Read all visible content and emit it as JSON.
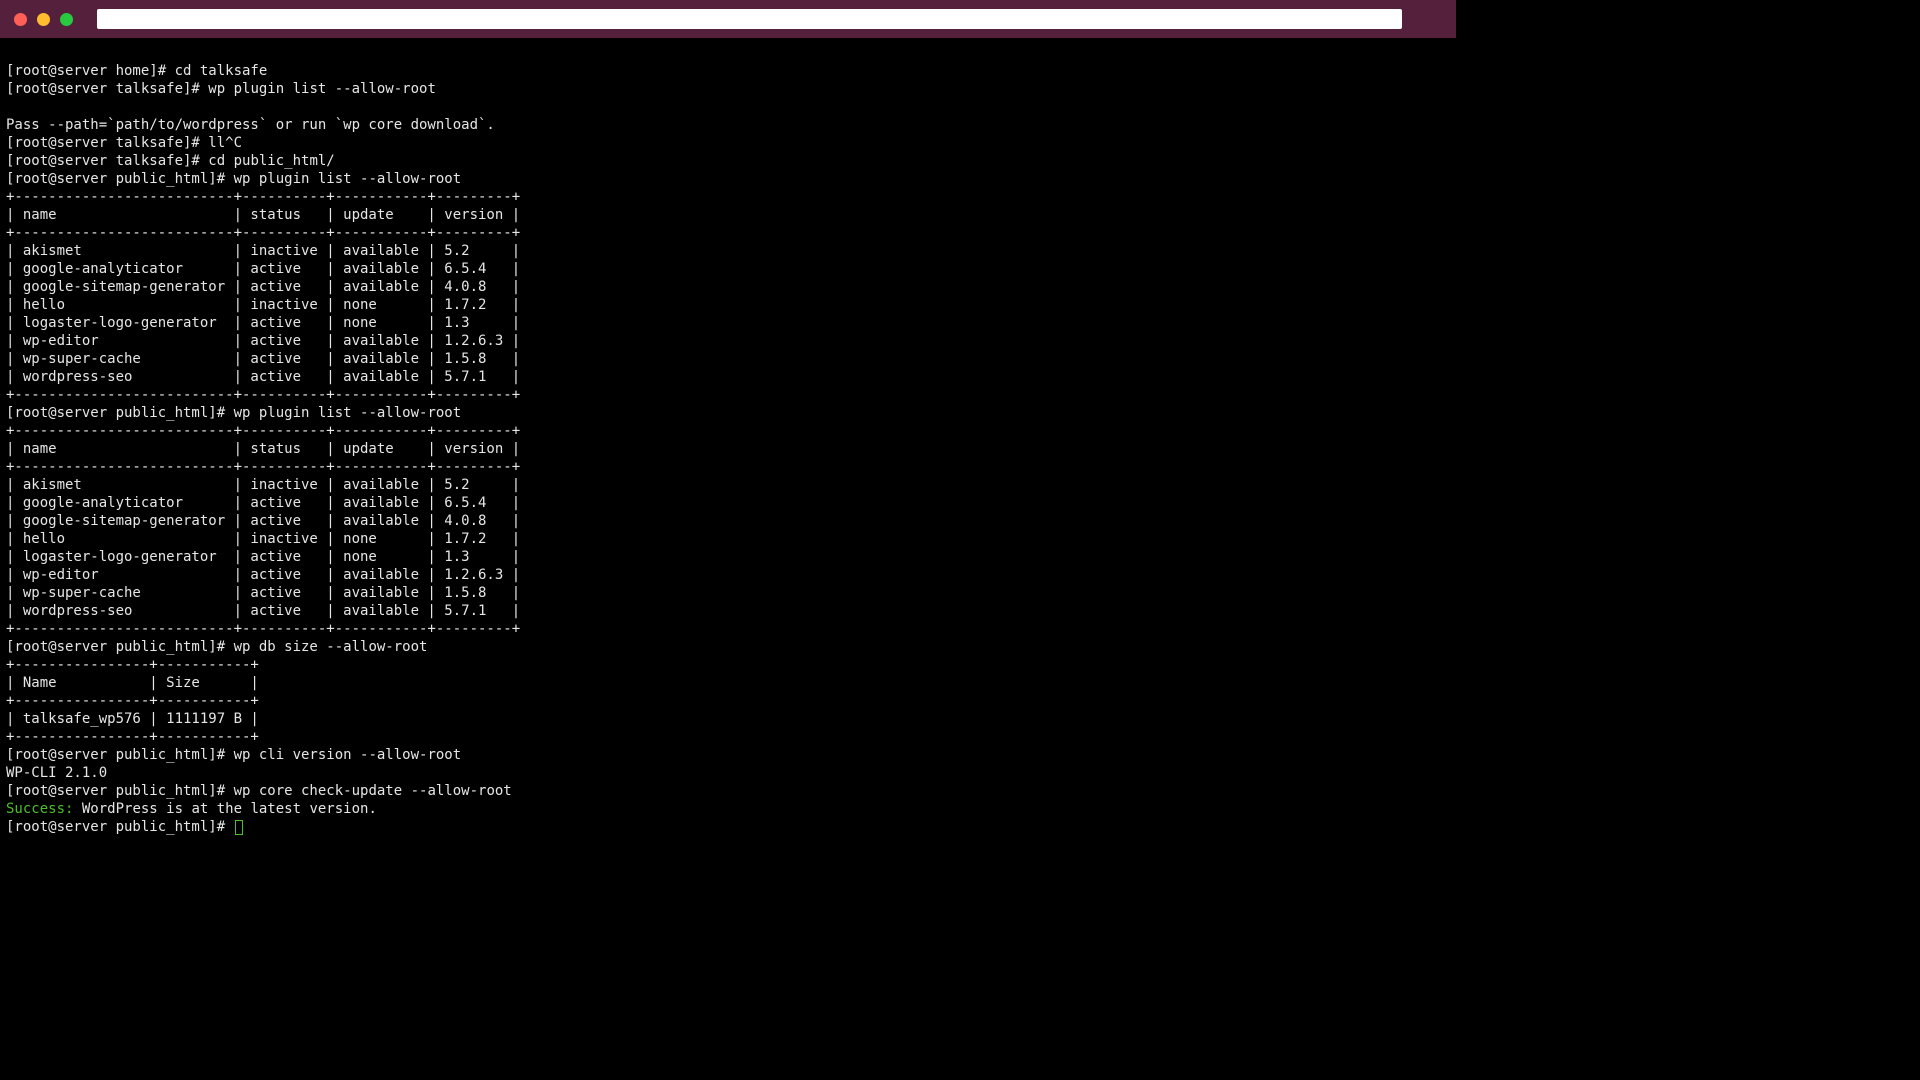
{
  "titlebar": {
    "title": ""
  },
  "prompts": {
    "home": "[root@server home]# ",
    "talksafe": "[root@server talksafe]# ",
    "public_html": "[root@server public_html]# "
  },
  "commands": {
    "cd_talksafe": "cd talksafe",
    "wp_plugin_list": "wp plugin list --allow-root",
    "ll_c": "ll^C",
    "cd_public": "cd public_html/",
    "wp_db_size": "wp db size --allow-root",
    "wp_cli_version": "wp cli version --allow-root",
    "wp_core_check": "wp core check-update --allow-root"
  },
  "messages": {
    "pass_hint": "Pass --path=`path/to/wordpress` or run `wp core download`.",
    "cli_version": "WP-CLI 2.1.0",
    "success_prefix": "Success:",
    "success_rest": " WordPress is at the latest version."
  },
  "plugin_table": {
    "sep_top": "+--------------------------+----------+-----------+---------+",
    "header": "| name                     | status   | update    | version |",
    "rows": [
      "| akismet                  | inactive | available | 5.2     |",
      "| google-analyticator      | active   | available | 6.5.4   |",
      "| google-sitemap-generator | active   | available | 4.0.8   |",
      "| hello                    | inactive | none      | 1.7.2   |",
      "| logaster-logo-generator  | active   | none      | 1.3     |",
      "| wp-editor                | active   | available | 1.2.6.3 |",
      "| wp-super-cache           | active   | available | 1.5.8   |",
      "| wordpress-seo            | active   | available | 5.7.1   |"
    ]
  },
  "db_table": {
    "sep": "+----------------+-----------+",
    "header": "| Name           | Size      |",
    "row": "| talksafe_wp576 | 1111197 B |"
  },
  "chart_data": {
    "type": "table",
    "tables": [
      {
        "title": "wp plugin list",
        "columns": [
          "name",
          "status",
          "update",
          "version"
        ],
        "rows": [
          [
            "akismet",
            "inactive",
            "available",
            "5.2"
          ],
          [
            "google-analyticator",
            "active",
            "available",
            "6.5.4"
          ],
          [
            "google-sitemap-generator",
            "active",
            "available",
            "4.0.8"
          ],
          [
            "hello",
            "inactive",
            "none",
            "1.7.2"
          ],
          [
            "logaster-logo-generator",
            "active",
            "none",
            "1.3"
          ],
          [
            "wp-editor",
            "active",
            "available",
            "1.2.6.3"
          ],
          [
            "wp-super-cache",
            "active",
            "available",
            "1.5.8"
          ],
          [
            "wordpress-seo",
            "active",
            "available",
            "5.7.1"
          ]
        ]
      },
      {
        "title": "wp db size",
        "columns": [
          "Name",
          "Size"
        ],
        "rows": [
          [
            "talksafe_wp576",
            "1111197 B"
          ]
        ]
      }
    ]
  }
}
